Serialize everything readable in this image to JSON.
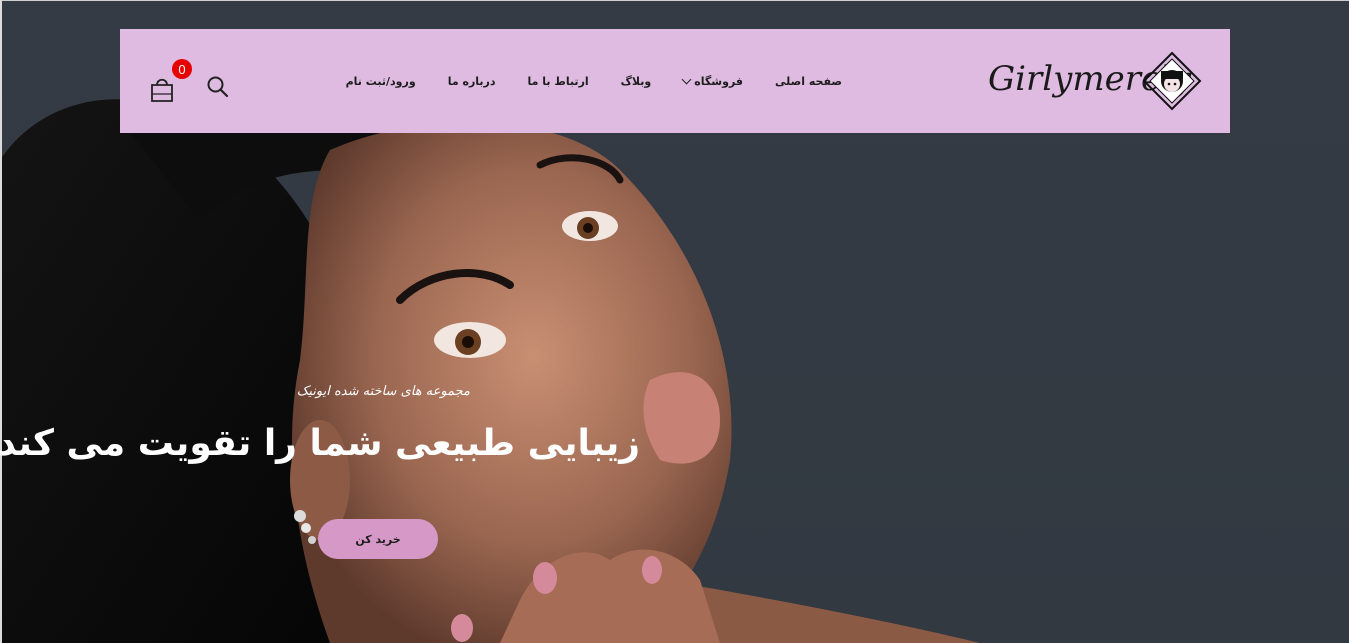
{
  "header": {
    "logo_text": "Girlymerely",
    "nav": [
      {
        "label": "صفحه اصلی"
      },
      {
        "label": "فروشگاه",
        "has_dropdown": true
      },
      {
        "label": "وبلاگ"
      },
      {
        "label": "ارتباط با ما"
      },
      {
        "label": "درباره ما"
      },
      {
        "label": "ورود/ثبت نام"
      }
    ],
    "cart_count": "0",
    "search_icon": "search-icon",
    "cart_icon": "shopping-bag-icon"
  },
  "hero": {
    "subtitle": "مجموعه های ساخته شده ایونیک",
    "headline": "زیبایی طبیعی شما را تقویت می کند",
    "cta_label": "خرید کن"
  },
  "colors": {
    "header_bg": "#dfbbe2",
    "cta_bg": "#d699c7",
    "badge_bg": "#e60000",
    "hero_bg": "#343b45"
  }
}
